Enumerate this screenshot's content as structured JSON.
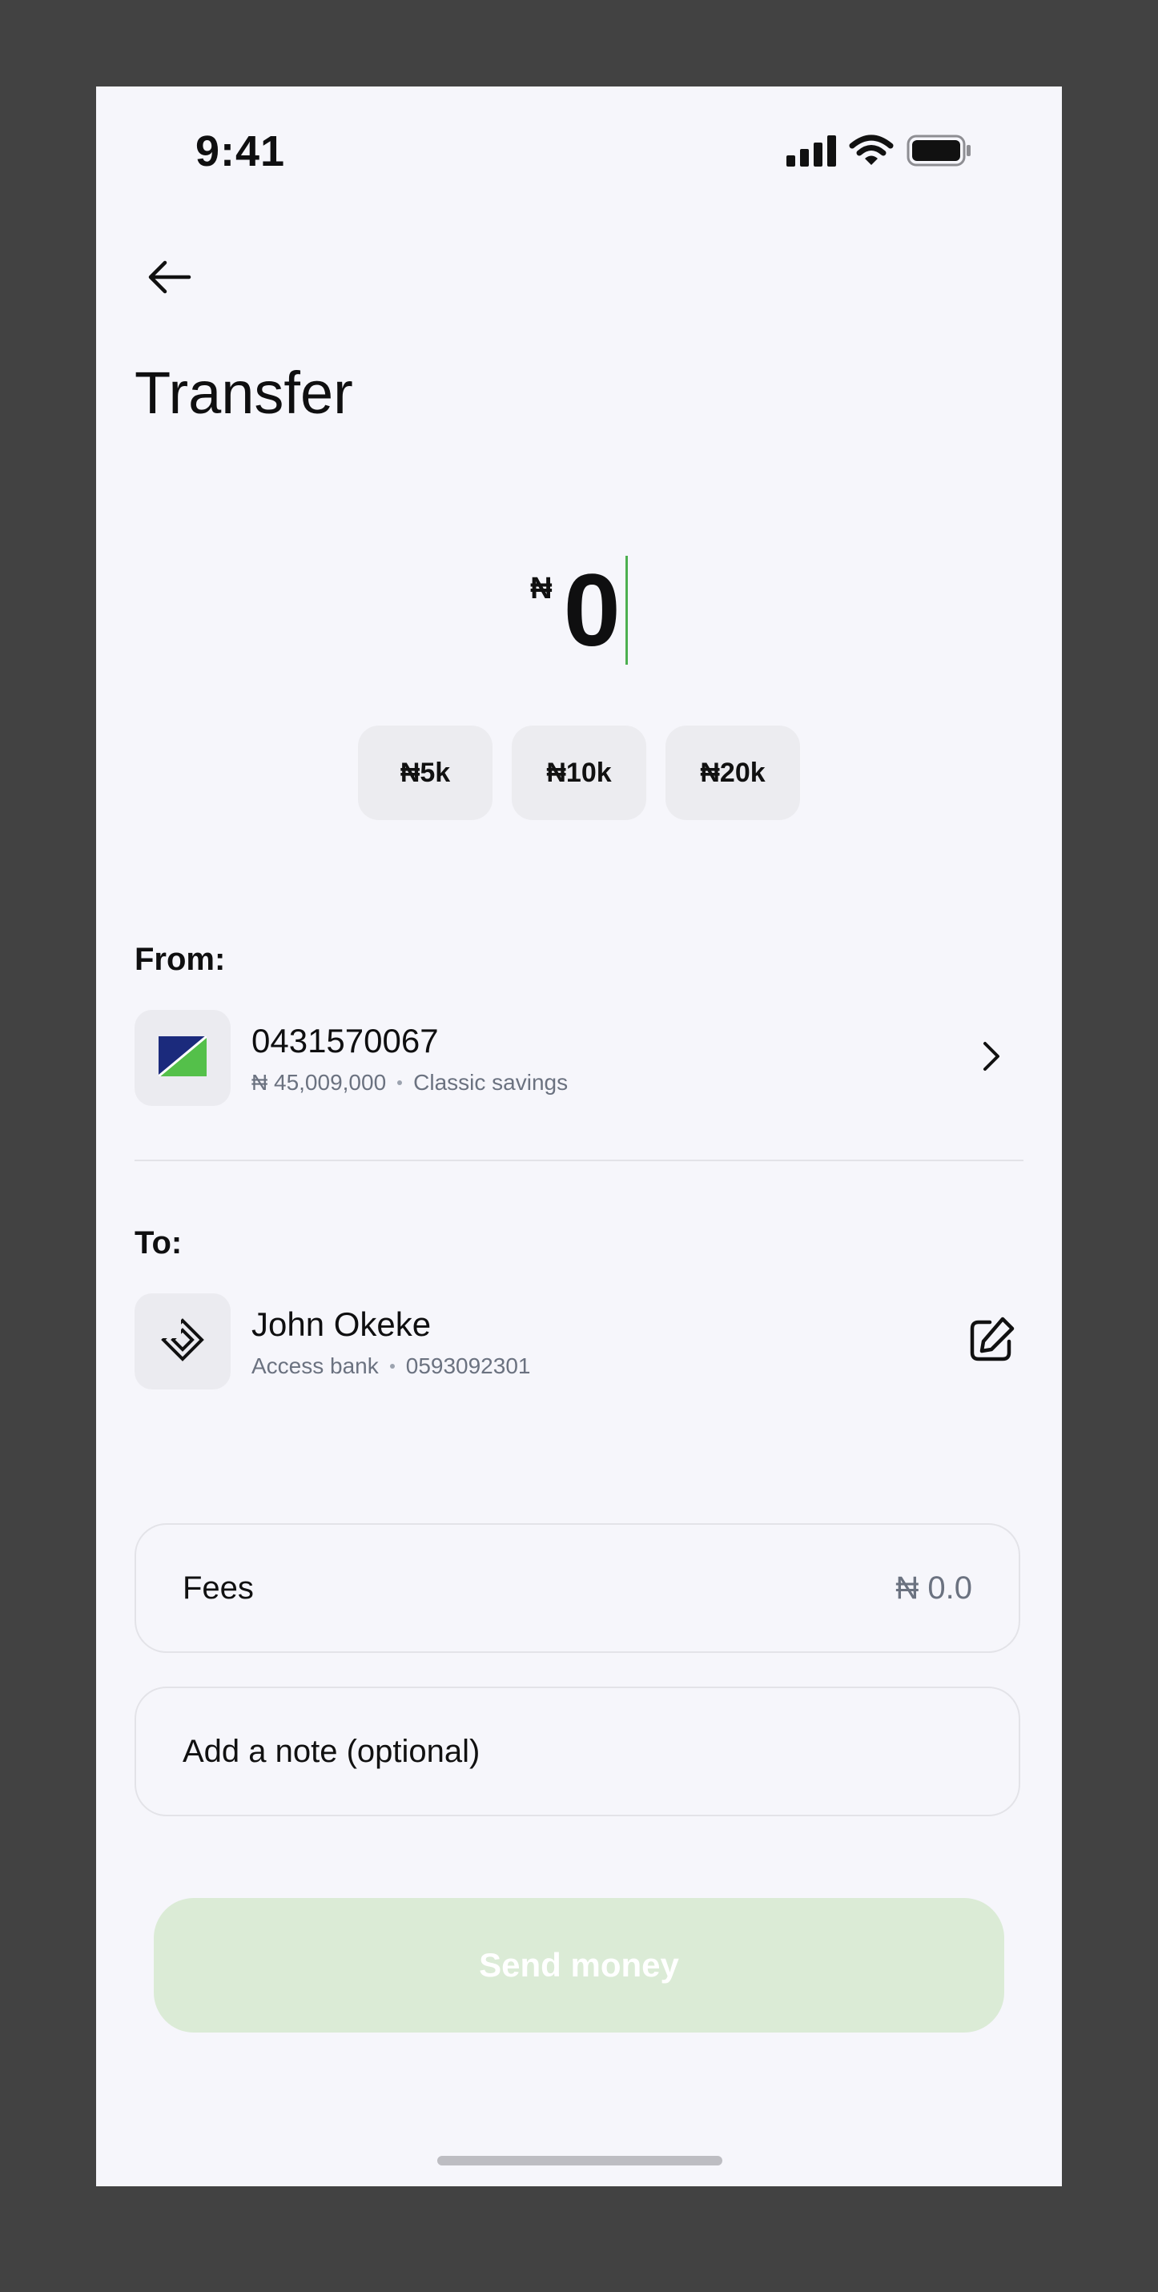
{
  "status_bar": {
    "time": "9:41"
  },
  "header": {
    "title": "Transfer"
  },
  "amount": {
    "currency_symbol": "₦",
    "value": "0"
  },
  "quick_amounts": [
    {
      "label": "₦5k"
    },
    {
      "label": "₦10k"
    },
    {
      "label": "₦20k"
    }
  ],
  "from": {
    "label": "From:",
    "account_number": "0431570067",
    "balance": "₦ 45,009,000",
    "account_type": "Classic savings"
  },
  "to": {
    "label": "To:",
    "name": "John Okeke",
    "bank": "Access bank",
    "account_number": "0593092301"
  },
  "fees": {
    "label": "Fees",
    "value": "₦ 0.0"
  },
  "note": {
    "placeholder": "Add a note (optional)"
  },
  "send_button": {
    "label": "Send money"
  },
  "colors": {
    "accent_green": "#4caf50",
    "send_button_disabled_bg": "#dbebd6",
    "bank_logo_navy": "#1b2a7c",
    "bank_logo_green": "#54c04a"
  },
  "icons": {
    "back": "arrow-left-icon",
    "from_action": "chevron-right-icon",
    "to_action": "edit-icon",
    "from_logo": "bank-logo-icon",
    "to_logo": "access-bank-logo-icon"
  }
}
